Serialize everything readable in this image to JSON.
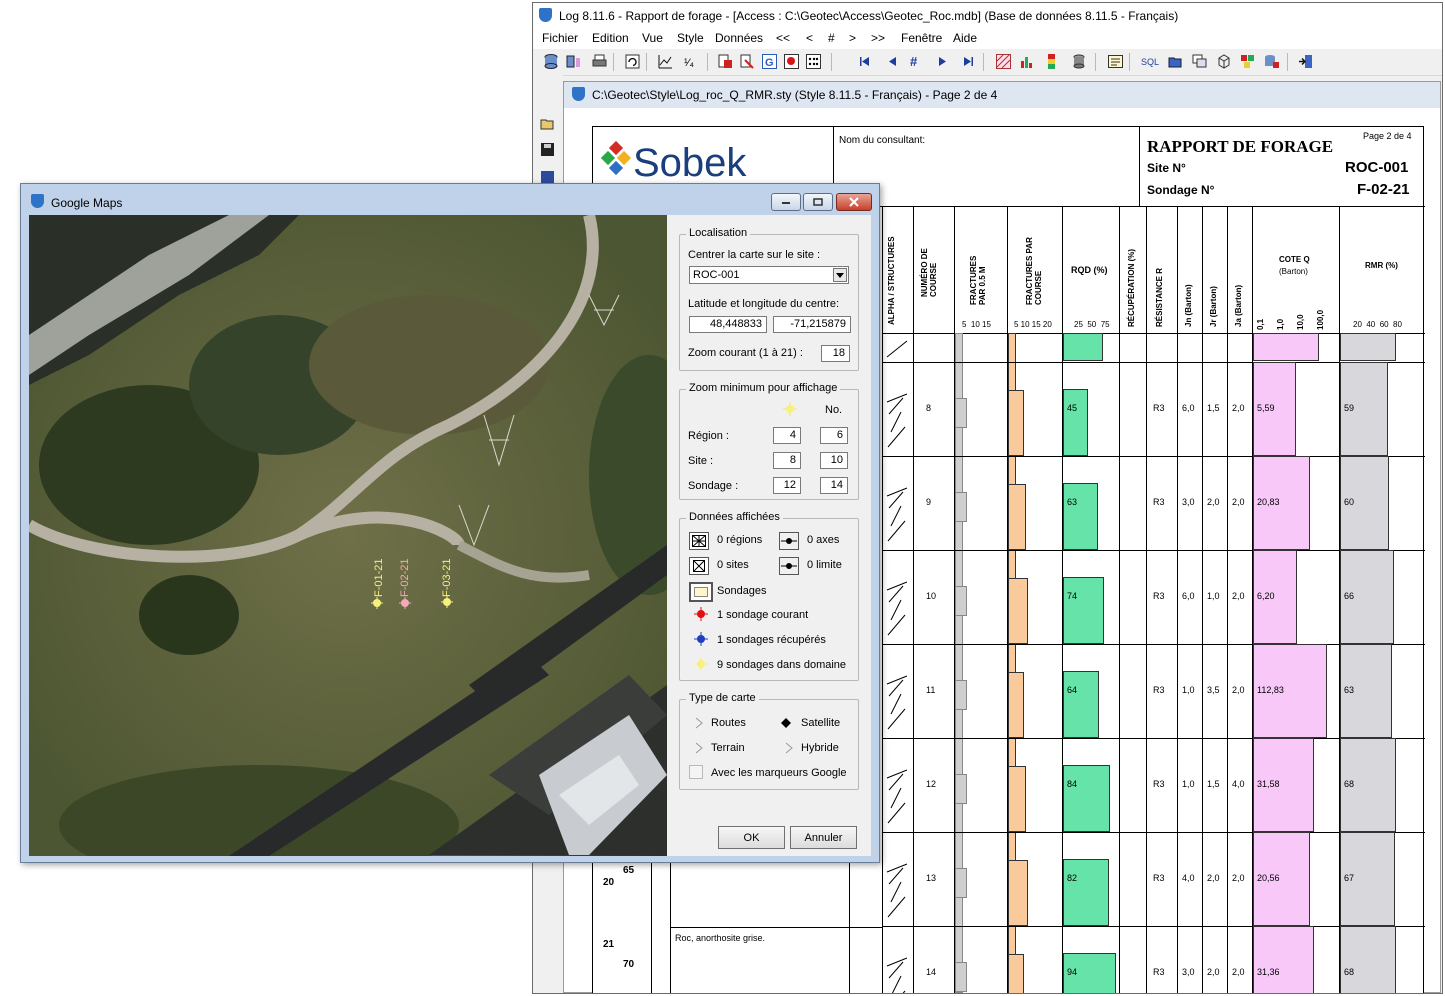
{
  "main_window": {
    "title": "Log 8.11.6 - Rapport de forage - [Access : C:\\Geotec\\Access\\Geotec_Roc.mdb] (Base de données 8.11.5 - Français)",
    "menus": [
      "Fichier",
      "Edition",
      "Vue",
      "Style",
      "Données",
      "<<",
      "<",
      "#",
      ">",
      ">>",
      "Fenêtre",
      "Aide"
    ],
    "toolbar_sql": "SQL",
    "child_title": "C:\\Geotec\\Style\\Log_roc_Q_RMR.sty (Style 8.11.5 - Français) - Page 2 de 4"
  },
  "report": {
    "logo": "Sobek",
    "consultant_label": "Nom du consultant:",
    "title": "RAPPORT DE FORAGE",
    "page_label": "Page 2  de 4",
    "site_label": "Site N°",
    "site_value": "ROC-001",
    "sondage_label": "Sondage N°",
    "sondage_value": "F-02-21",
    "columns": {
      "alpha": "ALPHA / STRUCTURES",
      "course": "NUMÉRO DE COURSE",
      "fractures_05": "FRACTURES PAR 0.5 M",
      "fractures_course": "FRACTURES PAR COURSE",
      "rqd": "RQD (%)",
      "recuperation": "RÉCUPÉRATION (%)",
      "resistance": "RÉSISTANCE R",
      "jn": "Jn (Barton)",
      "jr": "Jr (Barton)",
      "ja": "Ja (Barton)",
      "coteq": "COTE Q",
      "coteq_sub": "(Barton)",
      "rmr": "RMR (%)"
    },
    "scales": {
      "fr05": "5  10 15",
      "frcourse": "5 10 15 20",
      "rqd": "25  50  75",
      "q": [
        "0,1",
        "1,0",
        "10,0",
        "100,0"
      ],
      "rmr": "20  40  60  80"
    },
    "depth_labels": [
      {
        "elev": "65",
        "depth": "20"
      },
      {
        "elev": "70",
        "depth": "21"
      }
    ],
    "description": "Roc, anorthosite grise.",
    "rows": [
      {
        "course": "8",
        "rqd": "45",
        "r": "R3",
        "jn": "6,0",
        "jr": "1,5",
        "ja": "2,0",
        "q": "5,59",
        "rmr": "59",
        "rqd_frac": 0.45,
        "q_frac": 0.5,
        "rmr_frac": 0.59
      },
      {
        "course": "9",
        "rqd": "63",
        "r": "R3",
        "jn": "3,0",
        "jr": "2,0",
        "ja": "2,0",
        "q": "20,83",
        "rmr": "60",
        "rqd_frac": 0.63,
        "q_frac": 0.66,
        "rmr_frac": 0.6
      },
      {
        "course": "10",
        "rqd": "74",
        "r": "R3",
        "jn": "6,0",
        "jr": "1,0",
        "ja": "2,0",
        "q": "6,20",
        "rmr": "66",
        "rqd_frac": 0.74,
        "q_frac": 0.51,
        "rmr_frac": 0.66
      },
      {
        "course": "11",
        "rqd": "64",
        "r": "R3",
        "jn": "1,0",
        "jr": "3,5",
        "ja": "2,0",
        "q": "112,83",
        "rmr": "63",
        "rqd_frac": 0.64,
        "q_frac": 0.86,
        "rmr_frac": 0.63
      },
      {
        "course": "12",
        "rqd": "84",
        "r": "R3",
        "jn": "1,0",
        "jr": "1,5",
        "ja": "4,0",
        "q": "31,58",
        "rmr": "68",
        "rqd_frac": 0.84,
        "q_frac": 0.71,
        "rmr_frac": 0.68
      },
      {
        "course": "13",
        "rqd": "82",
        "r": "R3",
        "jn": "4,0",
        "jr": "2,0",
        "ja": "2,0",
        "q": "20,56",
        "rmr": "67",
        "rqd_frac": 0.82,
        "q_frac": 0.66,
        "rmr_frac": 0.67
      },
      {
        "course": "14",
        "rqd": "94",
        "r": "R3",
        "jn": "3,0",
        "jr": "2,0",
        "ja": "2,0",
        "q": "31,36",
        "rmr": "68",
        "rqd_frac": 0.94,
        "q_frac": 0.71,
        "rmr_frac": 0.68
      }
    ]
  },
  "google_maps": {
    "title": "Google Maps",
    "localisation": {
      "title": "Localisation",
      "center_label": "Centrer la carte sur le site :",
      "site_selected": "ROC-001",
      "latlon_label": "Latitude et longitude du centre:",
      "latitude": "48,448833",
      "longitude": "-71,215879",
      "zoom_label": "Zoom courant (1 à 21) :",
      "zoom_value": "18"
    },
    "zoom_min": {
      "title": "Zoom minimum pour affichage",
      "no_label": "No.",
      "region_label": "Région :",
      "region_values": [
        "4",
        "6"
      ],
      "site_label": "Site :",
      "site_values": [
        "8",
        "10"
      ],
      "sondage_label": "Sondage :",
      "sondage_values": [
        "12",
        "14"
      ]
    },
    "donnees": {
      "title": "Données affichées",
      "regions": "0 régions",
      "axes": "0 axes",
      "sites": "0 sites",
      "limite": "0 limite",
      "sondages": "Sondages",
      "courant": "1 sondage courant",
      "recuperes": "1 sondages récupérés",
      "domaine": "9 sondages dans domaine"
    },
    "type_carte": {
      "title": "Type de carte",
      "routes": "Routes",
      "satellite": "Satellite",
      "terrain": "Terrain",
      "hybride": "Hybride",
      "marqueurs": "Avec les marqueurs Google"
    },
    "ok": "OK",
    "cancel": "Annuler",
    "markers": [
      "F-01-21",
      "F-02-21",
      "F-03-21"
    ],
    "colors": {
      "current": "#e01010",
      "recovered": "#1f3fbf",
      "domain": "#f7f07a",
      "pink": "#f4a9b8"
    }
  }
}
